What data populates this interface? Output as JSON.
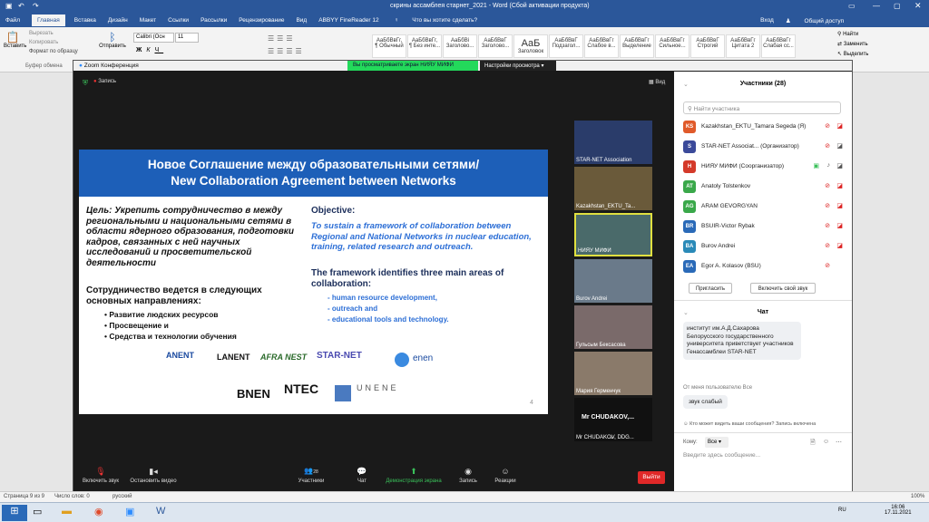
{
  "word": {
    "title": "скрины ассамблея старнет_2021 - Word (Сбой активации продукта)",
    "tabs": [
      "Файл",
      "Главная",
      "Вставка",
      "Дизайн",
      "Макет",
      "Ссылки",
      "Рассылки",
      "Рецензирование",
      "Вид",
      "ABBYY FineReader 12"
    ],
    "tell_me": "Что вы хотите сделать?",
    "user": "Вход",
    "share": "Общий доступ",
    "font_name": "Calibri (Осн",
    "font_size": "11",
    "clipboard": {
      "paste": "Вставить",
      "cut": "Вырезать",
      "copy": "Копировать",
      "format": "Формат по образцу",
      "group": "Буфер обмена"
    },
    "send": "Отправить",
    "styles": [
      {
        "preview": "АаБбВвГг,",
        "name": "¶ Обычный"
      },
      {
        "preview": "АаБбВвГг,",
        "name": "¶ Без инте..."
      },
      {
        "preview": "АаБбВі",
        "name": "Заголово..."
      },
      {
        "preview": "АаБбВвГ",
        "name": "Заголово..."
      },
      {
        "preview": "АаБ",
        "name": "Заголовок"
      },
      {
        "preview": "АаБбВвГ",
        "name": "Подзагол..."
      },
      {
        "preview": "АаБбВвГг",
        "name": "Слабое в..."
      },
      {
        "preview": "АаБбВвГг",
        "name": "Выделение"
      },
      {
        "preview": "АаБбВвГг",
        "name": "Сильное..."
      },
      {
        "preview": "АаБбВвГ",
        "name": "Строгий"
      },
      {
        "preview": "АаБбВвГг",
        "name": "Цитата 2"
      },
      {
        "preview": "АаБбВвГг",
        "name": "Слабая сс..."
      }
    ],
    "editing": {
      "find": "Найти",
      "replace": "Заменить",
      "select": "Выделить"
    },
    "status": {
      "page": "Страница 9 из 9",
      "words": "Число слов: 0",
      "lang": "русский",
      "zoom": "100%"
    }
  },
  "zoom": {
    "window_title": "Zoom Конференция",
    "viewing_banner": "Вы просматриваете экран НИЯУ МИФИ",
    "view_options": "Настройки просмотра",
    "recording": "Запись",
    "view_label": "Вид",
    "slide": {
      "title_ru": "Новое Соглашение между образовательными сетями/",
      "title_en": "New Collaboration Agreement between Networks",
      "goal_ru": "Цель: Укрепить сотрудничество в между региональными и национальными сетями в области ядерного образования, подготовки кадров, связанных с ней научных исследований и просветительской деятельности",
      "directions_ru": "Сотрудничество ведется в следующих основных направлениях:",
      "bullets_ru": [
        "Развитие людских ресурсов",
        "Просвещение и",
        "Средства и технологии обучения"
      ],
      "objective_title": "Objective:",
      "objective_text": "To sustain a framework of collaboration between Regional and National Networks in nuclear education, training, related research and outreach.",
      "framework_title": "The framework identifies three main areas of collaboration:",
      "bullets_en": [
        "human resource development,",
        "outreach and",
        "educational tools and technology."
      ],
      "logos": [
        "ANENT",
        "LANENT",
        "AFRA NEST",
        "STAR-NET",
        "enen",
        "BNEN",
        "NTEC",
        "UNENE"
      ],
      "page_number": "4"
    },
    "thumbnails": [
      {
        "label": "STAR-NET Association"
      },
      {
        "label": "Kazakhstan_EKTU_Ta..."
      },
      {
        "label": "НИЯУ МИФИ"
      },
      {
        "label": "Burov Andrei"
      },
      {
        "label": "Гульсым Бексасова"
      },
      {
        "label": "Мария Герменчук"
      },
      {
        "label": "Mr CHUDAKOV, DDG..."
      }
    ],
    "thumb_name_card": "Mr CHUDAKOV,...",
    "toolbar": {
      "mute": "Включить звук",
      "video": "Остановить видео",
      "participants": "Участники",
      "participants_count": "28",
      "chat": "Чат",
      "share": "Демонстрация экрана",
      "record": "Запись",
      "reactions": "Реакции",
      "leave": "Выйти"
    },
    "participants_panel": {
      "title": "Участники (28)",
      "search_placeholder": "Найти участника",
      "invite": "Пригласить",
      "unmute_me": "Включить свой звук",
      "items": [
        {
          "initials": "KS",
          "name": "Kazakhstan_EKTU_Tamara Segeda (Я)",
          "color": "#e05a2a"
        },
        {
          "initials": "S",
          "name": "STAR-NET Associat... (Организатор)",
          "color": "#3b4a9a"
        },
        {
          "initials": "Н",
          "name": "НИЯУ МИФИ (Соорганизатор)",
          "color": "#d43a2a"
        },
        {
          "initials": "AT",
          "name": "Anatoly Tolstenkov",
          "color": "#3aa84a"
        },
        {
          "initials": "AG",
          "name": "ARAM GEVORGYAN",
          "color": "#3aa84a"
        },
        {
          "initials": "BR",
          "name": "BSUIR-Victor Rybak",
          "color": "#2a6ab8"
        },
        {
          "initials": "BA",
          "name": "Burov Andrei",
          "color": "#2a8ab8"
        },
        {
          "initials": "EA",
          "name": "Egor A. Kolasov (BSU)",
          "color": "#2a6ab8"
        }
      ]
    },
    "chat_panel": {
      "title": "Чат",
      "message1": "институт им.А.Д.Сахарова Белорусского государственного университета приветствует участников Генассамблеи STAR-NET",
      "from_line": "От меня пользователю Все",
      "message2": "звук слабый",
      "who_can_see": "Кто может видеть ваши сообщения? Запись включена",
      "to_label": "Кому:",
      "to_value": "Все",
      "input_placeholder": "Введите здесь сообщение..."
    }
  },
  "taskbar": {
    "time": "16:06",
    "date": "17.11.2021",
    "lang": "RU"
  }
}
